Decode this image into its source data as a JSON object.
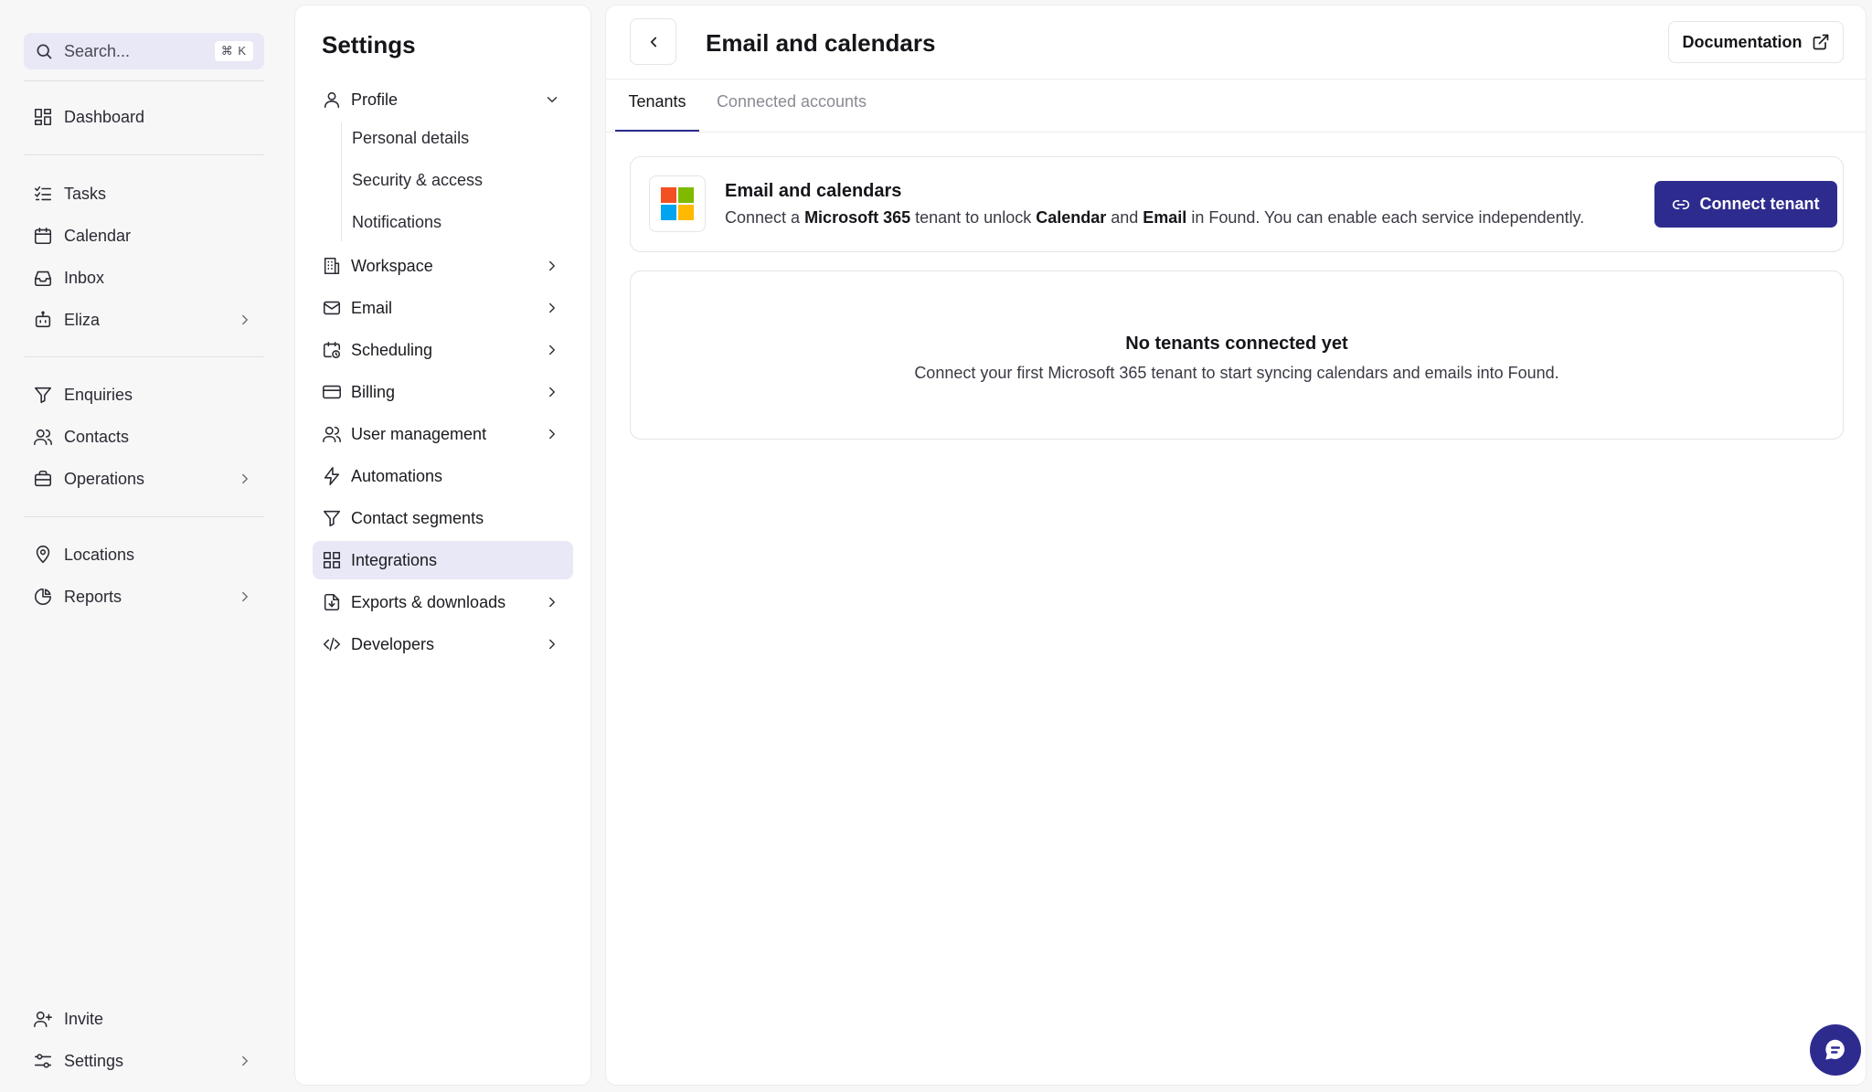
{
  "search": {
    "placeholder": "Search...",
    "shortcut": "⌘ K"
  },
  "sidebar": {
    "items": [
      {
        "id": "dashboard",
        "label": "Dashboard",
        "icon": "dashboard-icon",
        "has_chevron": false
      },
      {
        "id": "tasks",
        "label": "Tasks",
        "icon": "tasks-icon",
        "has_chevron": false
      },
      {
        "id": "calendar",
        "label": "Calendar",
        "icon": "calendar-icon",
        "has_chevron": false
      },
      {
        "id": "inbox",
        "label": "Inbox",
        "icon": "inbox-icon",
        "has_chevron": false
      },
      {
        "id": "eliza",
        "label": "Eliza",
        "icon": "bot-icon",
        "has_chevron": true
      },
      {
        "id": "enquiries",
        "label": "Enquiries",
        "icon": "filter-icon",
        "has_chevron": false
      },
      {
        "id": "contacts",
        "label": "Contacts",
        "icon": "users-icon",
        "has_chevron": false
      },
      {
        "id": "operations",
        "label": "Operations",
        "icon": "briefcase-icon",
        "has_chevron": true
      },
      {
        "id": "locations",
        "label": "Locations",
        "icon": "map-pin-icon",
        "has_chevron": false
      },
      {
        "id": "reports",
        "label": "Reports",
        "icon": "pie-chart-icon",
        "has_chevron": true
      }
    ],
    "bottom": [
      {
        "id": "invite",
        "label": "Invite",
        "icon": "user-plus-icon",
        "has_chevron": false
      },
      {
        "id": "settings",
        "label": "Settings",
        "icon": "sliders-icon",
        "has_chevron": true
      }
    ]
  },
  "settings": {
    "title": "Settings",
    "items": [
      {
        "id": "profile",
        "label": "Profile",
        "icon": "user-icon",
        "expanded": true
      },
      {
        "id": "workspace",
        "label": "Workspace",
        "icon": "building-icon"
      },
      {
        "id": "email",
        "label": "Email",
        "icon": "mail-icon"
      },
      {
        "id": "scheduling",
        "label": "Scheduling",
        "icon": "calendar-clock-icon"
      },
      {
        "id": "billing",
        "label": "Billing",
        "icon": "credit-card-icon"
      },
      {
        "id": "user-management",
        "label": "User management",
        "icon": "users-icon"
      },
      {
        "id": "automations",
        "label": "Automations",
        "icon": "zap-icon"
      },
      {
        "id": "contact-segments",
        "label": "Contact segments",
        "icon": "filter-icon"
      },
      {
        "id": "integrations",
        "label": "Integrations",
        "icon": "grid-icon",
        "active": true
      },
      {
        "id": "exports",
        "label": "Exports & downloads",
        "icon": "file-download-icon"
      },
      {
        "id": "developers",
        "label": "Developers",
        "icon": "code-icon"
      }
    ],
    "profile_sub": [
      "Personal details",
      "Security & access",
      "Notifications"
    ]
  },
  "main": {
    "title": "Email and calendars",
    "documentation_label": "Documentation",
    "tabs": [
      {
        "label": "Tenants",
        "active": true
      },
      {
        "label": "Connected accounts",
        "active": false
      }
    ],
    "card": {
      "title": "Email and calendars",
      "desc_1": "Connect a ",
      "desc_b1": "Microsoft 365",
      "desc_2": " tenant to unlock ",
      "desc_b2": "Calendar",
      "desc_3": " and ",
      "desc_b3": "Email",
      "desc_4": " in Found. You can enable each service independently.",
      "button_label": "Connect tenant"
    },
    "empty": {
      "title": "No tenants connected yet",
      "description": "Connect your first Microsoft 365 tenant to start syncing calendars and emails into Found."
    }
  },
  "colors": {
    "accent": "#2e2b8f",
    "active_bg": "#e8e8f6",
    "ms_red": "#f25022",
    "ms_green": "#7fba00",
    "ms_blue": "#00a4ef",
    "ms_yellow": "#ffb900"
  }
}
